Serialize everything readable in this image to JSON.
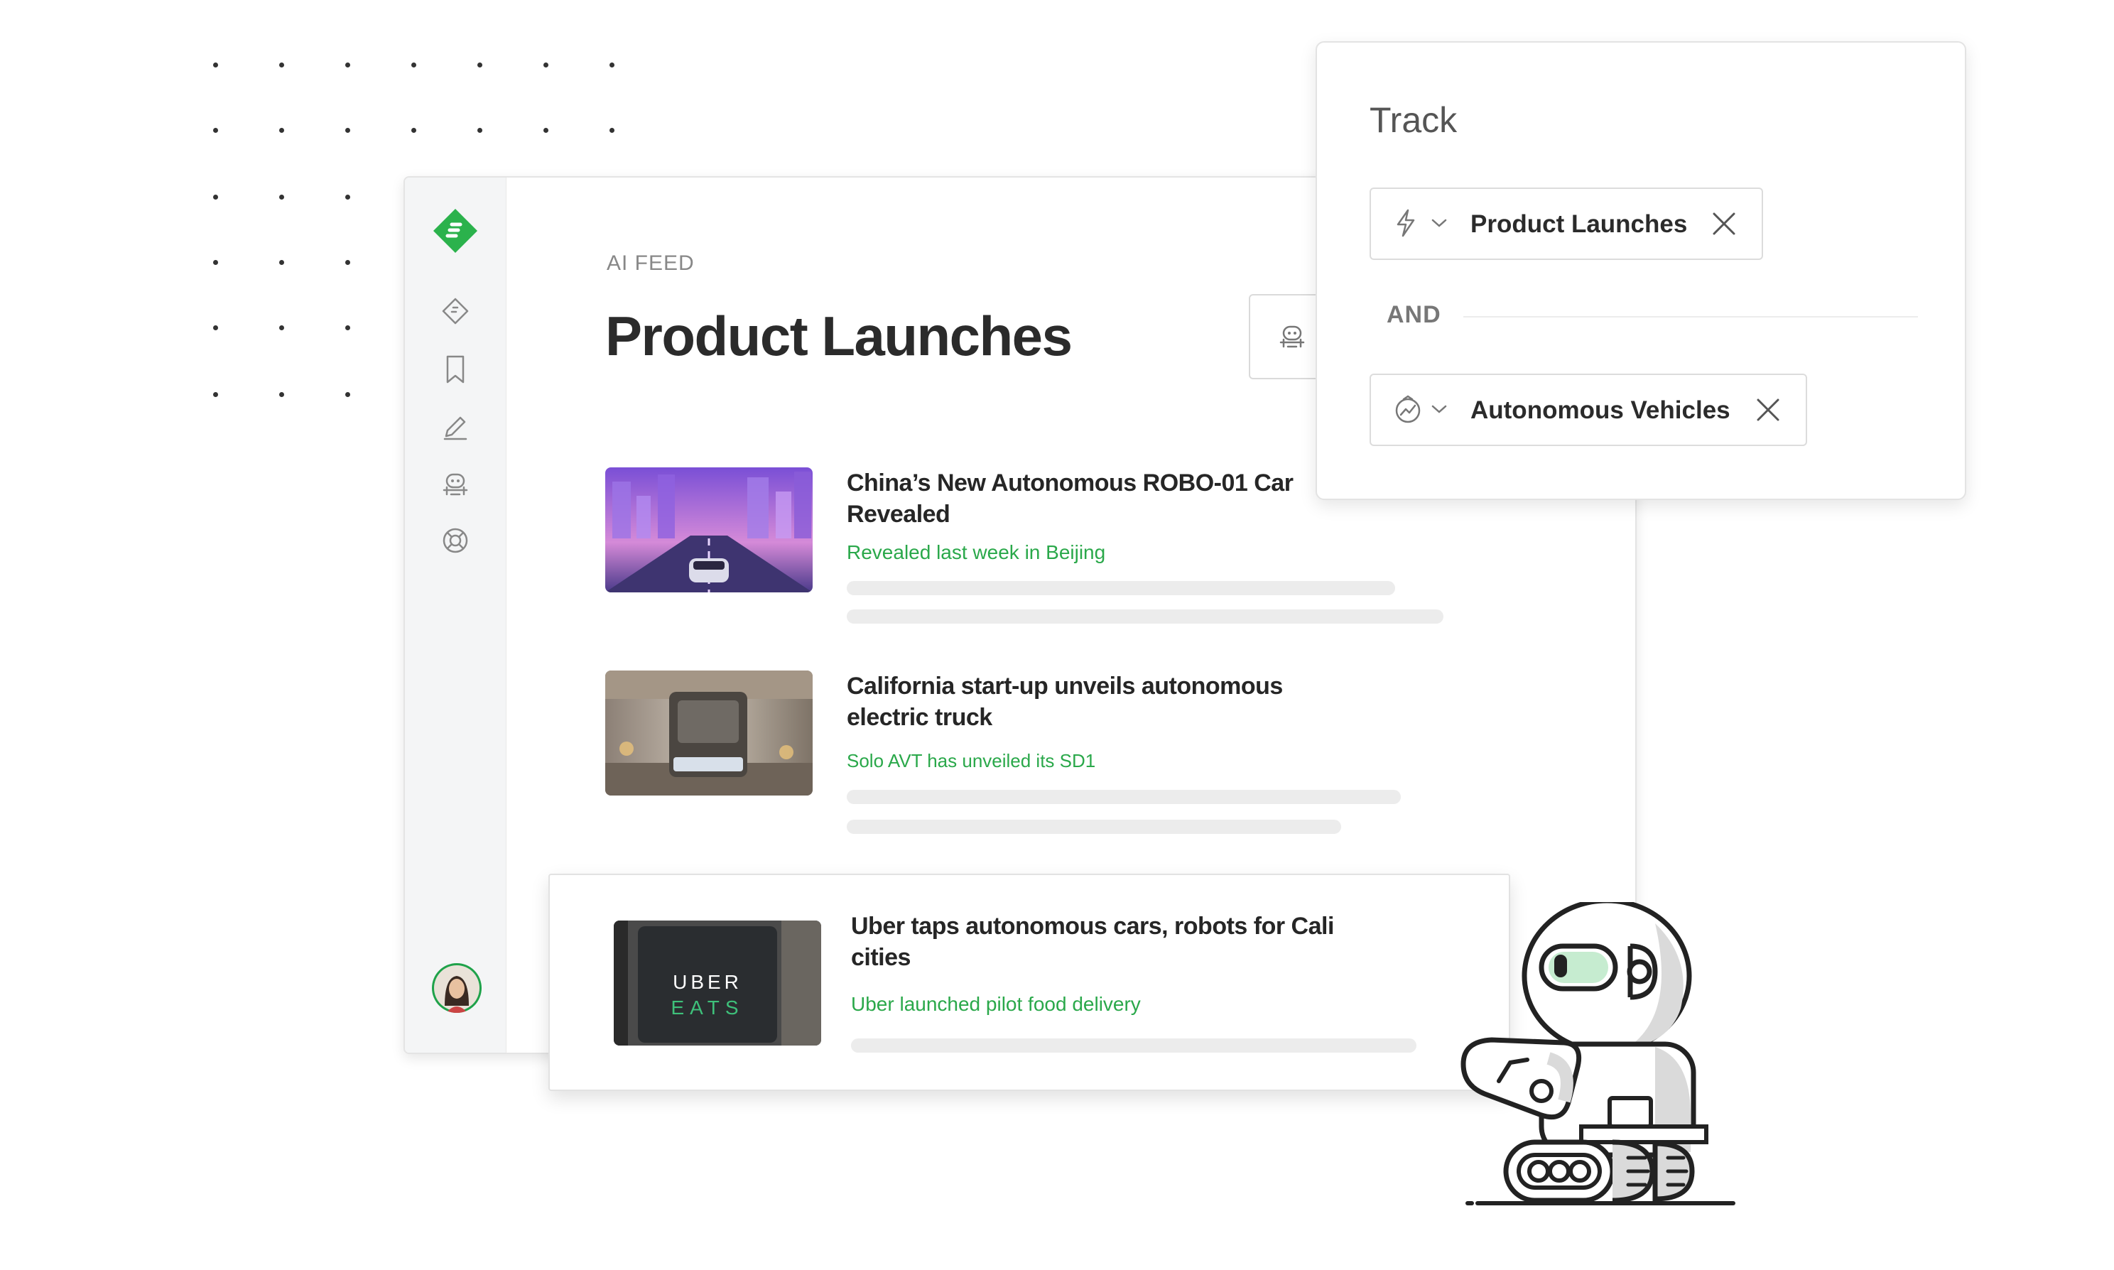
{
  "app": {
    "feed_label": "AI FEED",
    "page_title": "Product Launches"
  },
  "articles": [
    {
      "title": "China’s New Autonomous ROBO-01 Car Revealed",
      "subtitle": "Revealed last week in Beijing"
    },
    {
      "title": "California start-up unveils autonomous electric truck",
      "subtitle": "Solo AVT has unveiled its SD1"
    },
    {
      "title": "Uber taps autonomous cars, robots for Cali cities",
      "subtitle": "Uber launched pilot food delivery",
      "thumb_text_top": "UBER",
      "thumb_text_bottom": "EATS"
    }
  ],
  "track": {
    "title": "Track",
    "chip1": {
      "label": "Product Launches",
      "icon": "lightning-icon"
    },
    "operator": "AND",
    "chip2": {
      "label": "Autonomous Vehicles",
      "icon": "trend-icon"
    }
  },
  "colors": {
    "accent_green": "#2aa84a",
    "logo_green": "#2bb24c",
    "title_dark": "#2b2b2b"
  }
}
